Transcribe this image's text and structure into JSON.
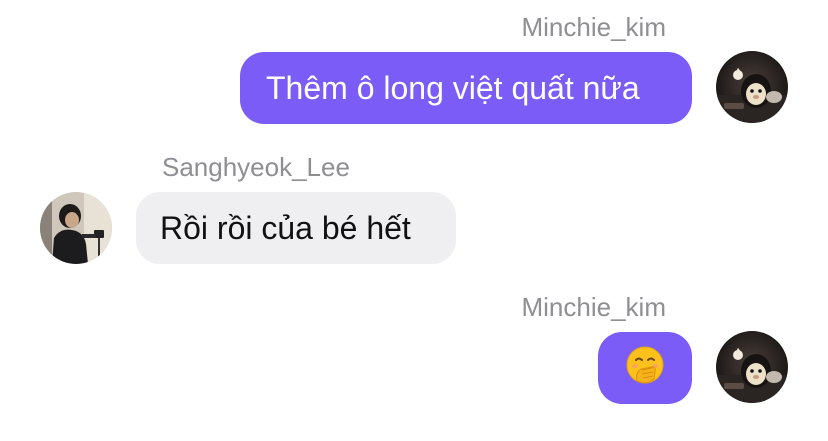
{
  "conversation": {
    "messages": [
      {
        "sender": "Minchie_kim",
        "text": "Thêm ô long việt quất nữa",
        "direction": "outgoing"
      },
      {
        "sender": "Sanghyeok_Lee",
        "text": "Rồi rồi của bé hết",
        "direction": "incoming"
      },
      {
        "sender": "Minchie_kim",
        "text": "🤭",
        "direction": "outgoing"
      }
    ]
  },
  "theme": {
    "outgoing_bubble_color": "#7c5cf6",
    "incoming_bubble_color": "#efeff1",
    "sender_name_color": "#8e8e93"
  },
  "icons": {
    "minchie_avatar": "avatar-photo-dark-plush-toy",
    "sanghyeok_avatar": "avatar-photo-person-with-camera",
    "emoji": "face-with-hand-over-mouth"
  }
}
